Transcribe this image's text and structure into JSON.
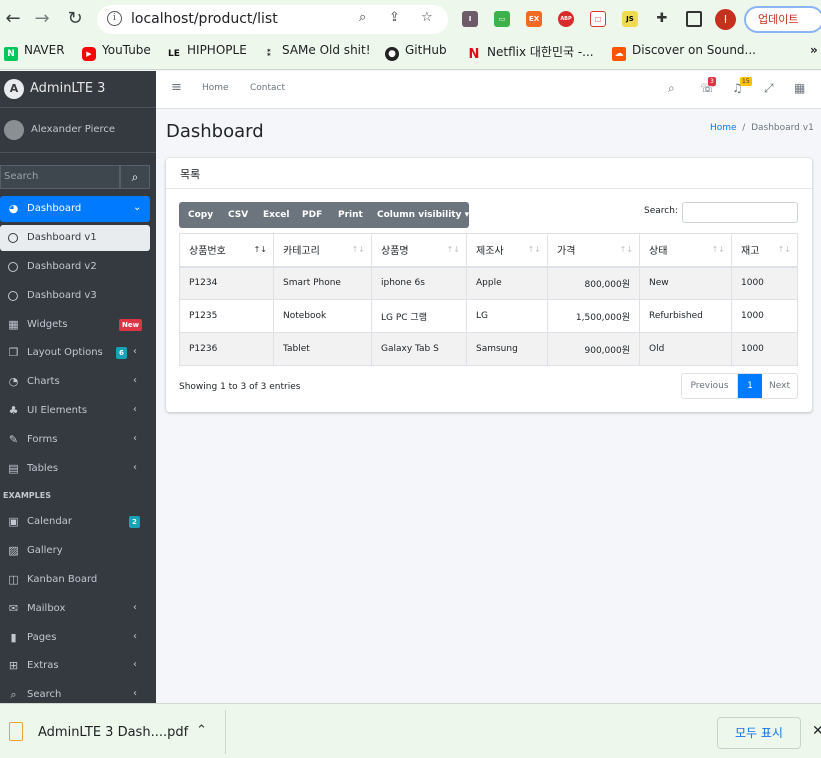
{
  "browser": {
    "url": "localhost/product/list",
    "update_label": "업데이트",
    "profile_initial": "I",
    "bookmarks": [
      {
        "label": "NAVER",
        "icon": "naver-icon"
      },
      {
        "label": "YouTube",
        "icon": "youtube-icon"
      },
      {
        "label": "HIPHOPLE",
        "icon": "hiphople-icon"
      },
      {
        "label": "SAMe Old shit!",
        "icon": "same-icon"
      },
      {
        "label": "GitHub",
        "icon": "github-icon"
      },
      {
        "label": "Netflix 대한민국 -...",
        "icon": "netflix-icon"
      },
      {
        "label": "Discover on Sound...",
        "icon": "soundcloud-icon"
      }
    ],
    "extensions": [
      "I",
      "EX",
      "ABP",
      "JS"
    ]
  },
  "sidebar": {
    "brand": "AdminLTE 3",
    "brand_logo": "A",
    "user": "Alexander Pierce",
    "search_placeholder": "Search",
    "items": [
      {
        "label": "Dashboard",
        "icon": "dashboard-icon"
      },
      {
        "label": "Dashboard v1"
      },
      {
        "label": "Dashboard v2"
      },
      {
        "label": "Dashboard v3"
      },
      {
        "label": "Widgets",
        "icon": "widgets-icon",
        "badge": "New"
      },
      {
        "label": "Layout Options",
        "icon": "copy-icon",
        "badge": "6"
      },
      {
        "label": "Charts",
        "icon": "chart-pie-icon"
      },
      {
        "label": "UI Elements",
        "icon": "tree-icon"
      },
      {
        "label": "Forms",
        "icon": "edit-icon"
      },
      {
        "label": "Tables",
        "icon": "table-icon"
      },
      {
        "label": "Calendar",
        "icon": "calendar-icon",
        "badge": "2"
      },
      {
        "label": "Gallery",
        "icon": "image-icon"
      },
      {
        "label": "Kanban Board",
        "icon": "columns-icon"
      },
      {
        "label": "Mailbox",
        "icon": "envelope-icon"
      },
      {
        "label": "Pages",
        "icon": "book-icon"
      },
      {
        "label": "Extras",
        "icon": "plus-square-icon"
      },
      {
        "label": "Search",
        "icon": "search-icon"
      }
    ],
    "section_examples": "EXAMPLES"
  },
  "topnav": {
    "links": [
      "Home",
      "Contact"
    ],
    "messages_badge": "3",
    "notifications_badge": "15"
  },
  "page": {
    "title": "Dashboard",
    "breadcrumb_home": "Home",
    "breadcrumb_current": "Dashboard v1"
  },
  "card": {
    "title": "목록",
    "buttons": [
      "Copy",
      "CSV",
      "Excel",
      "PDF",
      "Print",
      "Column visibility"
    ],
    "search_label": "Search:",
    "table": {
      "headers": [
        "상품번호",
        "카테고리",
        "상품명",
        "제조사",
        "가격",
        "상태",
        "재고"
      ],
      "rows": [
        [
          "P1234",
          "Smart Phone",
          "iphone 6s",
          "Apple",
          "800,000원",
          "New",
          "1000"
        ],
        [
          "P1235",
          "Notebook",
          "LG PC 그램",
          "LG",
          "1,500,000원",
          "Refurbished",
          "1000"
        ],
        [
          "P1236",
          "Tablet",
          "Galaxy Tab S",
          "Samsung",
          "900,000원",
          "Old",
          "1000"
        ]
      ]
    },
    "info": "Showing 1 to 3 of 3 entries",
    "pager": {
      "previous": "Previous",
      "current": "1",
      "next": "Next"
    }
  },
  "downloads": {
    "file": "AdminLTE 3   Dash....pdf",
    "show_all": "모두 표시"
  }
}
